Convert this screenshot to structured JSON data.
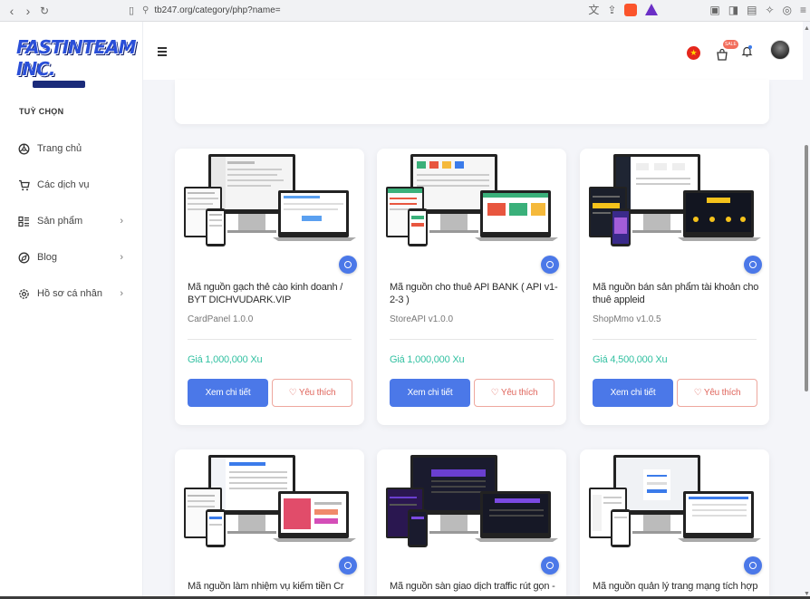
{
  "browser": {
    "url": "tb247.org/category/php?name="
  },
  "sidebar": {
    "logo_text": "FASTINTEAM INC.",
    "menu_title": "TUỲ CHỌN",
    "items": [
      {
        "label": "Trang chủ",
        "icon": "dashboard-icon",
        "has_chevron": false
      },
      {
        "label": "Các dịch vụ",
        "icon": "cart-icon",
        "has_chevron": false
      },
      {
        "label": "Sản phẩm",
        "icon": "list-icon",
        "has_chevron": true
      },
      {
        "label": "Blog",
        "icon": "blog-icon",
        "has_chevron": true
      },
      {
        "label": "Hồ sơ cá nhân",
        "icon": "gear-icon",
        "has_chevron": true
      }
    ]
  },
  "topbar": {
    "cart_badge": "SALE"
  },
  "products": [
    {
      "title": "Mã nguồn gạch thẻ cào kinh doanh / BYT DICHVUDARK.VIP",
      "version": "CardPanel 1.0.0",
      "price": "Giá 1,000,000 Xu",
      "detail_label": "Xem chi tiết",
      "like_label": "♡ Yêu thích"
    },
    {
      "title": "Mã nguồn cho thuê API BANK ( API v1-2-3 )",
      "version": "StoreAPI v1.0.0",
      "price": "Giá 1,000,000 Xu",
      "detail_label": "Xem chi tiết",
      "like_label": "♡ Yêu thích"
    },
    {
      "title": "Mã nguồn bán sản phẩm tài khoản cho thuê appleid",
      "version": "ShopMmo v1.0.5",
      "price": "Giá 4,500,000 Xu",
      "detail_label": "Xem chi tiết",
      "like_label": "♡ Yêu thích"
    },
    {
      "title": "Mã nguồn làm nhiệm vụ kiếm tiền Cr"
    },
    {
      "title": "Mã nguồn sàn giao dịch traffic rút gọn -"
    },
    {
      "title": "Mã nguồn quản lý trang mạng tích hợp"
    }
  ],
  "colors": {
    "primary": "#4b78e8",
    "price": "#33c1a2",
    "like": "#e0675e"
  }
}
